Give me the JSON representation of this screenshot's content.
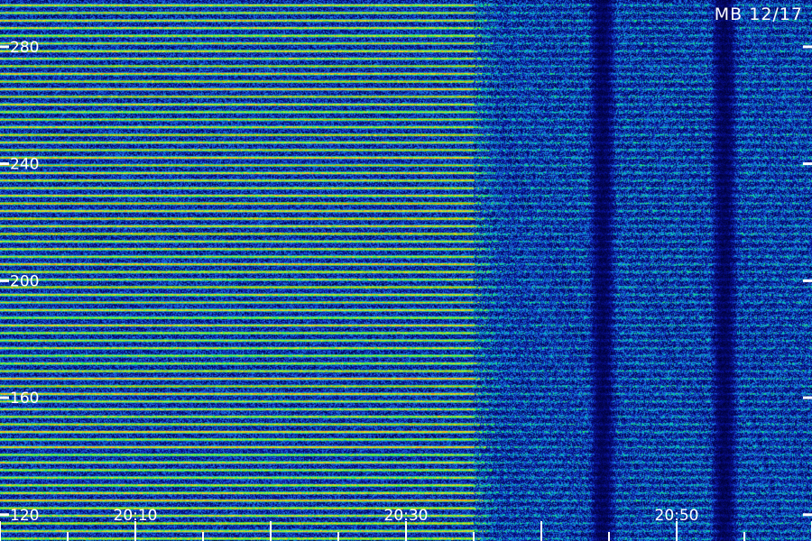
{
  "chart_data": {
    "type": "heatmap",
    "title": "MB 12/17",
    "xlabel": "",
    "ylabel": "",
    "x_tick_labels": [
      "20:10",
      "20:30",
      "20:50"
    ],
    "y_tick_labels": [
      "280",
      "240",
      "200",
      "160",
      "120"
    ],
    "y_ticks": [
      280,
      240,
      200,
      160,
      120
    ],
    "ylim": [
      111,
      296
    ],
    "x_ticks_minutes": [
      10,
      30,
      50
    ],
    "xlim_minutes": [
      0,
      60
    ],
    "colormap": [
      "#000033",
      "#0a14a0",
      "#1e6ee6",
      "#00c8c8",
      "#32f03c",
      "#f0e61e",
      "#ff8c00"
    ],
    "description_levels": {
      "strong_band_region_end_minute": 35,
      "dark_columns_minutes": [
        44.5,
        53.5
      ]
    },
    "grid": false,
    "legend": "none"
  }
}
